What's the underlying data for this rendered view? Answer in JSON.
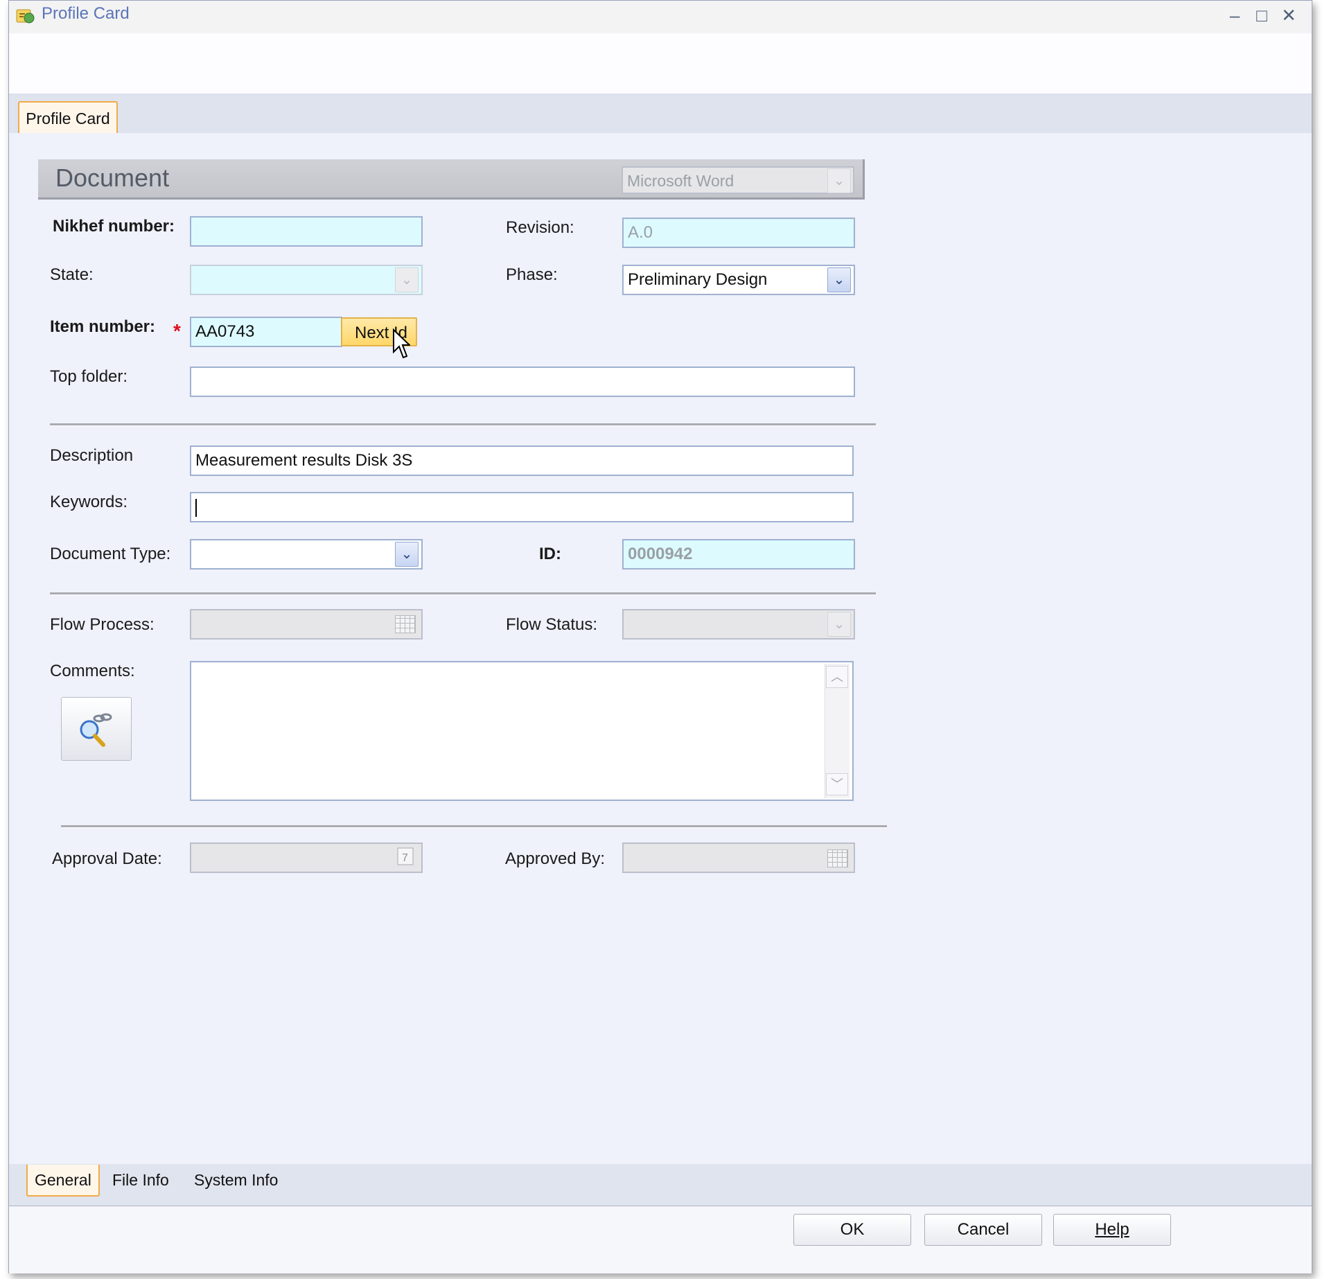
{
  "window": {
    "title": "Profile Card",
    "controls": {
      "minimize": "–",
      "maximize": "□",
      "close": "✕"
    }
  },
  "top_tab": {
    "label": "Profile Card"
  },
  "section": {
    "title": "Document",
    "app_select": {
      "value": "Microsoft Word"
    }
  },
  "fields": {
    "nikhef_number": {
      "label": "Nikhef number:",
      "value": ""
    },
    "revision": {
      "label": "Revision:",
      "value": "A.0"
    },
    "state": {
      "label": "State:",
      "value": ""
    },
    "phase": {
      "label": "Phase:",
      "value": "Preliminary Design"
    },
    "item_number": {
      "label": "Item number:",
      "required_marker": "*",
      "value": "AA0743",
      "next_button": "Next Id"
    },
    "top_folder": {
      "label": "Top folder:",
      "value": ""
    },
    "description": {
      "label": "Description",
      "value": "Measurement results Disk 3S"
    },
    "keywords": {
      "label": "Keywords:",
      "value": ""
    },
    "document_type": {
      "label": "Document Type:",
      "value": ""
    },
    "id": {
      "label": "ID:",
      "value": "0000942"
    },
    "flow_process": {
      "label": "Flow Process:",
      "value": ""
    },
    "flow_status": {
      "label": "Flow Status:",
      "value": ""
    },
    "comments": {
      "label": "Comments:",
      "value": ""
    },
    "approval_date": {
      "label": "Approval Date:",
      "value": ""
    },
    "approved_by": {
      "label": "Approved By:",
      "value": ""
    }
  },
  "bottom_tabs": [
    {
      "label": "General",
      "active": true
    },
    {
      "label": "File Info",
      "active": false
    },
    {
      "label": "System Info",
      "active": false
    }
  ],
  "buttons": {
    "ok": "OK",
    "cancel": "Cancel",
    "help": "Help"
  },
  "colors": {
    "required_field": "#ddfbff",
    "accent_tab": "#f1a94a",
    "title_text": "#5b74b8",
    "next_button": "#ffd76a"
  }
}
